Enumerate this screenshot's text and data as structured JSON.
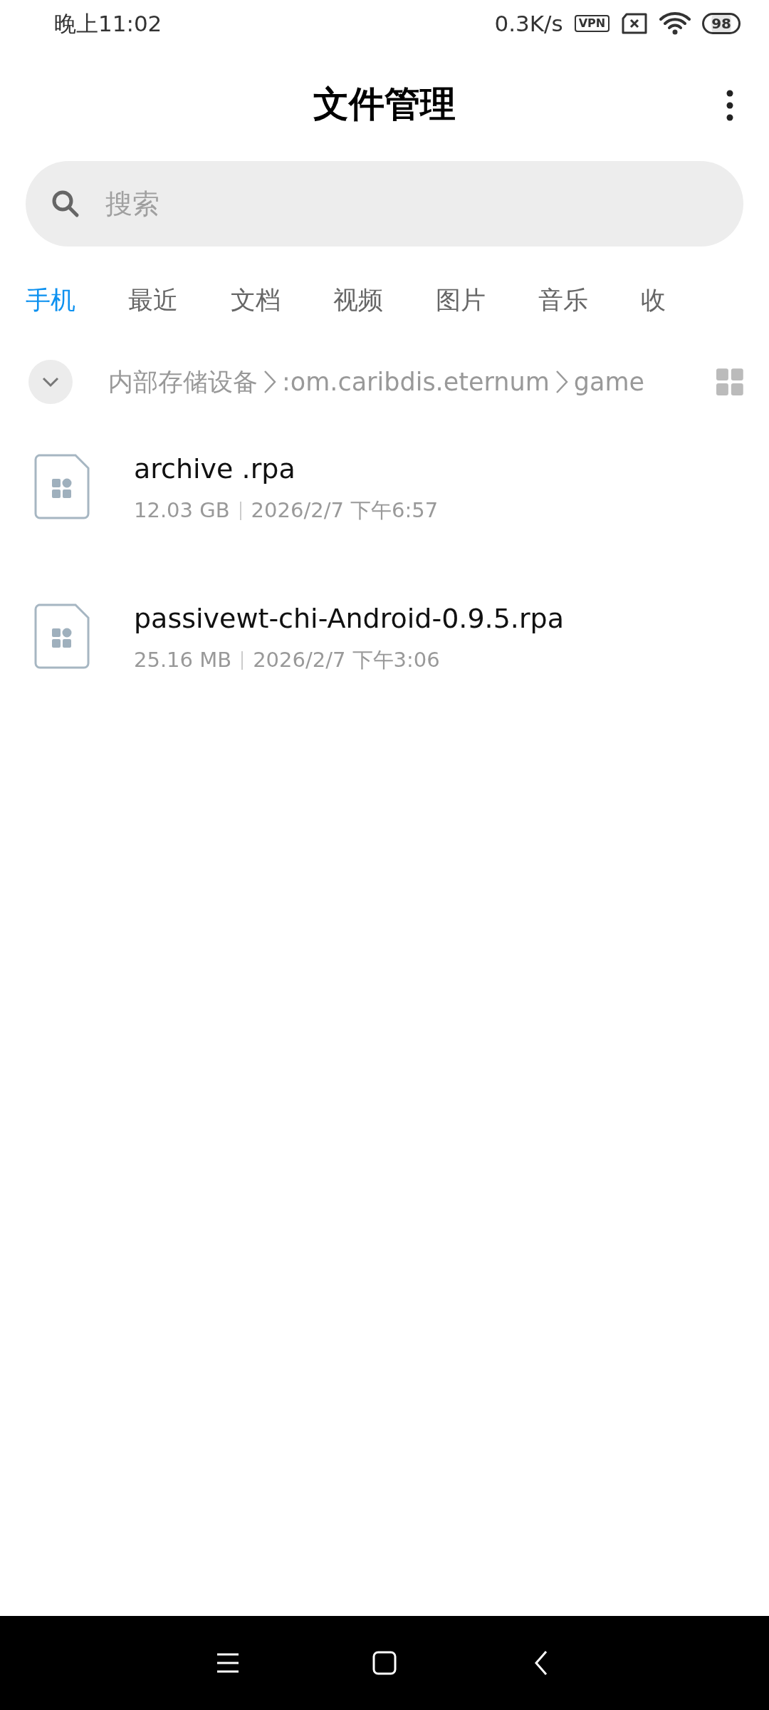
{
  "status_bar": {
    "time": "晚上11:02",
    "speed": "0.3K/s",
    "vpn": "VPN",
    "battery": "98"
  },
  "header": {
    "title": "文件管理"
  },
  "search": {
    "placeholder": "搜索"
  },
  "tabs": [
    {
      "label": "手机",
      "selected": true
    },
    {
      "label": "最近",
      "selected": false
    },
    {
      "label": "文档",
      "selected": false
    },
    {
      "label": "视频",
      "selected": false
    },
    {
      "label": "图片",
      "selected": false
    },
    {
      "label": "音乐",
      "selected": false
    },
    {
      "label": "收",
      "selected": false
    }
  ],
  "breadcrumb": [
    "内部存储设备",
    ":om.caribdis.eternum",
    "game"
  ],
  "files": [
    {
      "name": "archive .rpa",
      "size": "12.03 GB",
      "date": "2026/2/7 下午6:57"
    },
    {
      "name": "passivewt-chi-Android-0.9.5.rpa",
      "size": "25.16 MB",
      "date": "2026/2/7 下午3:06"
    }
  ]
}
